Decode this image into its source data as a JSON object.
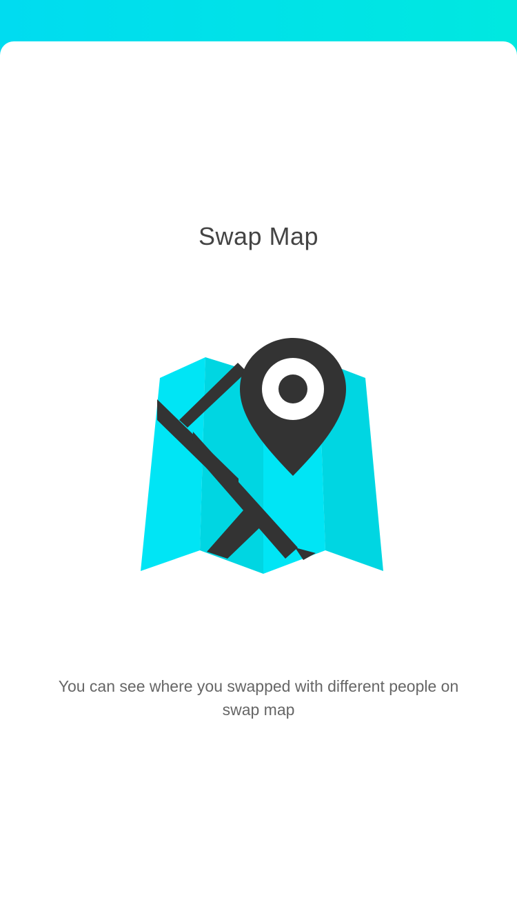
{
  "onboarding": {
    "title": "Swap Map",
    "description": "You can see where you swapped with different people on swap map",
    "illustration": "folded-map-with-location-pin-icon"
  },
  "colors": {
    "accent": "#00e5f5",
    "map_light": "#00e5f5",
    "map_dark": "#00d4e0",
    "road": "#333333",
    "pin": "#333333",
    "text_title": "#444444",
    "text_body": "#666666"
  }
}
